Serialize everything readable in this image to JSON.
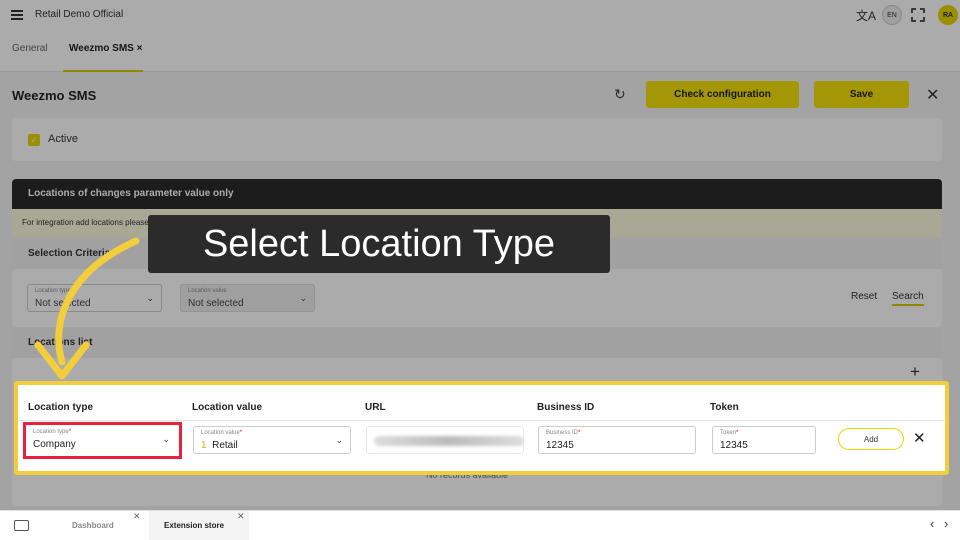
{
  "topbar": {
    "app_title": "Retail Demo Official",
    "lang": "EN",
    "avatar": "RA"
  },
  "tabs": [
    {
      "label": "General"
    },
    {
      "label": "Weezmo SMS",
      "close": "×"
    }
  ],
  "header": {
    "title": "Weezmo SMS",
    "check_config": "Check configuration",
    "save": "Save"
  },
  "active": {
    "label": "Active",
    "checked": true
  },
  "locations_section": {
    "title": "Locations of changes parameter value only",
    "note": "For integration add locations please"
  },
  "selection": {
    "title": "Selection Criteria",
    "location_type": {
      "label": "Location type",
      "value": "Not selected"
    },
    "location_value": {
      "label": "Location value",
      "value": "Not selected"
    },
    "reset": "Reset",
    "search": "Search"
  },
  "list": {
    "title": "Locations list",
    "add_icon": "+",
    "no_records": "No records available"
  },
  "table": {
    "columns": [
      "Location type",
      "Location value",
      "URL",
      "Business ID",
      "Token"
    ],
    "row": {
      "location_type_label": "Location type",
      "location_type_value": "Company",
      "location_value_label": "Location value",
      "location_value_num": "1",
      "location_value_value": "Retail",
      "business_id_label": "Business ID",
      "business_id_value": "12345",
      "token_label": "Token",
      "token_value": "12345",
      "add_label": "Add"
    }
  },
  "callout": "Select Location Type",
  "bottom": {
    "tabs": [
      "Dashboard",
      "Extension store"
    ]
  },
  "colors": {
    "accent": "#f4e20b",
    "highlight": "#f2cd3c",
    "red": "#e8223a"
  }
}
